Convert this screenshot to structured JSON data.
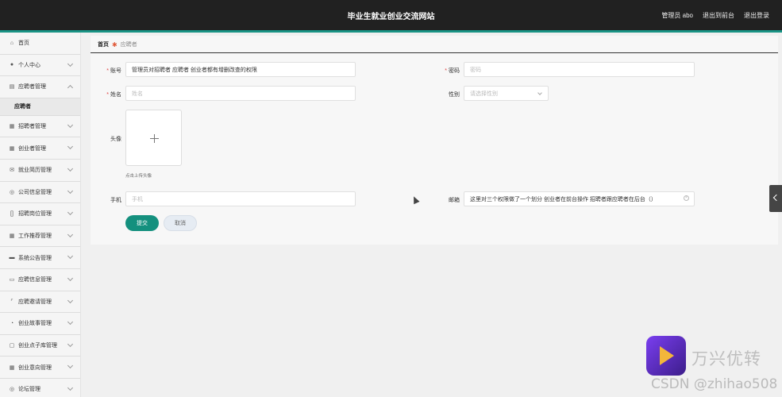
{
  "header": {
    "title": "毕业生就业创业交流网站",
    "user": "管理员 abo",
    "back_label": "退出到前台",
    "logout_label": "退出登录"
  },
  "sidebar": {
    "items": [
      {
        "label": "首页",
        "icon": "home-icon",
        "chevron": "none"
      },
      {
        "label": "个人中心",
        "icon": "user-icon",
        "chevron": "down"
      },
      {
        "label": "应聘者管理",
        "icon": "list-icon",
        "chevron": "up"
      },
      {
        "label": "招聘者管理",
        "icon": "grid-icon",
        "chevron": "down"
      },
      {
        "label": "创业者管理",
        "icon": "grid-icon",
        "chevron": "down"
      },
      {
        "label": "就业简历管理",
        "icon": "mail-icon",
        "chevron": "down"
      },
      {
        "label": "公司信息管理",
        "icon": "compass-icon",
        "chevron": "down"
      },
      {
        "label": "招聘岗位管理",
        "icon": "bracket-icon",
        "chevron": "down"
      },
      {
        "label": "工作推荐管理",
        "icon": "grid-icon",
        "chevron": "down"
      },
      {
        "label": "系统公告管理",
        "icon": "briefcase-icon",
        "chevron": "down"
      },
      {
        "label": "应聘信息管理",
        "icon": "card-icon",
        "chevron": "down"
      },
      {
        "label": "应聘邀请管理",
        "icon": "crop-icon",
        "chevron": "down"
      },
      {
        "label": "创业故事管理",
        "icon": "gauge-icon",
        "chevron": "down"
      },
      {
        "label": "创业点子库管理",
        "icon": "chat-icon",
        "chevron": "down"
      },
      {
        "label": "创业意向管理",
        "icon": "grid-icon",
        "chevron": "down"
      },
      {
        "label": "论坛管理",
        "icon": "compass-icon",
        "chevron": "down"
      }
    ],
    "subitem": "应聘者"
  },
  "breadcrumb": {
    "home": "首页",
    "current": "应聘者"
  },
  "form": {
    "account_label": "账号",
    "account_value": "管理员对招聘者 应聘者 创业者都有增删改查的权限",
    "password_label": "密码",
    "password_placeholder": "密码",
    "name_label": "姓名",
    "name_placeholder": "姓名",
    "gender_label": "性别",
    "gender_placeholder": "请选择性别",
    "avatar_label": "头像",
    "avatar_hint": "点击上传头像",
    "phone_label": "手机",
    "phone_placeholder": "手机",
    "email_label": "邮箱",
    "email_value": "这里对三个权限做了一个划分 创业者在前台操作 招聘者跟应聘者在后台（）",
    "submit_label": "提交",
    "cancel_label": "取消"
  },
  "watermark": {
    "brand": "万兴优转",
    "csdn": "CSDN @zhihao508"
  }
}
